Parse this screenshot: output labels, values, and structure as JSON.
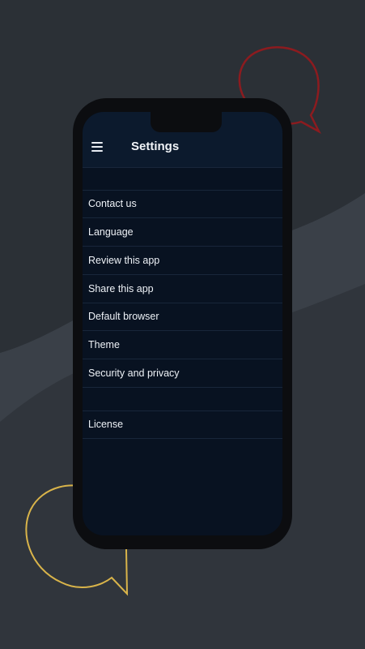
{
  "colors": {
    "background": "#2b3036",
    "screen": "#081221",
    "appbar": "#0c1a2d",
    "accent_red": "#8c1b1f",
    "accent_yellow": "#d9b44a"
  },
  "appbar": {
    "title": "Settings",
    "menu_icon": "hamburger-menu-icon"
  },
  "settings": {
    "items": [
      {
        "label": "Contact us"
      },
      {
        "label": "Language"
      },
      {
        "label": "Review this app"
      },
      {
        "label": "Share this app"
      },
      {
        "label": "Default browser"
      },
      {
        "label": "Theme"
      },
      {
        "label": "Security and privacy"
      },
      {
        "label": "License"
      }
    ]
  },
  "decorations": {
    "top_bubble": "chat-bubble-outline-icon",
    "bottom_bubble": "chat-bubble-outline-icon"
  }
}
